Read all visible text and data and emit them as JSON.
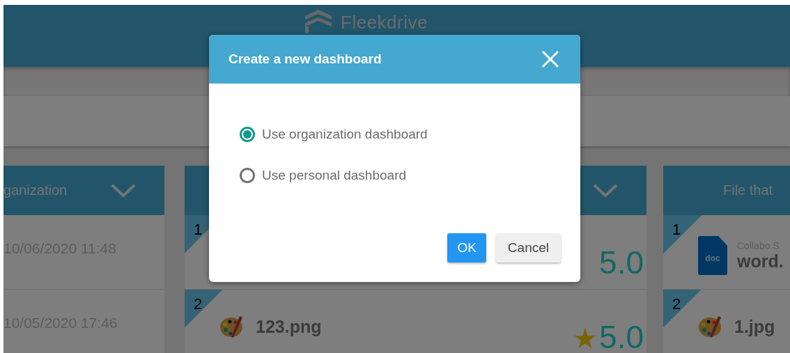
{
  "header": {
    "logo_text": "Fleekdrive"
  },
  "columns": [
    {
      "title": "ganization",
      "rows": [
        {
          "kind": "date",
          "text": "10/06/2020 11:48"
        },
        {
          "kind": "date",
          "text": "10/05/2020 17:46"
        }
      ]
    },
    {
      "rows": [
        {
          "kind": "rated",
          "rank": "1",
          "rating": "5.0"
        },
        {
          "kind": "rated_image",
          "rank": "2",
          "name": "123.png",
          "star": "★",
          "rating": "5.0"
        }
      ]
    },
    {
      "title": "File that",
      "rows": [
        {
          "kind": "doc_file",
          "rank": "1",
          "subtitle": "Collabo S",
          "icon_label": "doc",
          "name": "word."
        },
        {
          "kind": "image_file",
          "rank": "2",
          "name": "1.jpg"
        }
      ]
    }
  ],
  "dialog": {
    "title": "Create a new dashboard",
    "options": [
      {
        "label": "Use organization dashboard",
        "selected": true
      },
      {
        "label": "Use personal dashboard",
        "selected": false
      }
    ],
    "buttons": [
      {
        "label": "OK",
        "kind": "primary"
      },
      {
        "label": "Cancel",
        "kind": "secondary"
      }
    ]
  }
}
